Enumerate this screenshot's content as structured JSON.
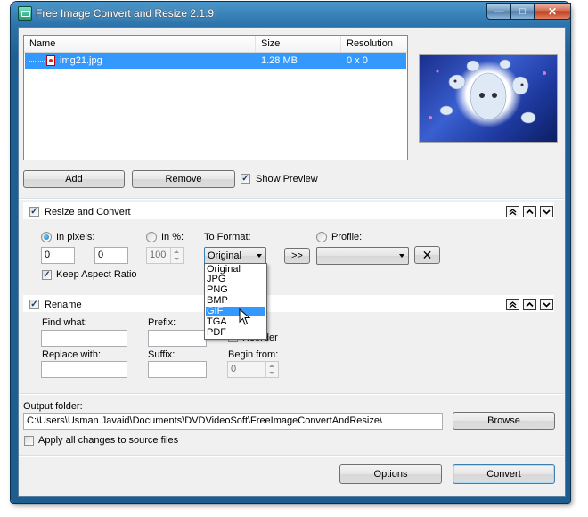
{
  "window": {
    "title": "Free Image Convert and Resize 2.1.9",
    "minimize_glyph": "—",
    "maximize_glyph": "□",
    "close_glyph": "✕"
  },
  "file_list": {
    "columns": [
      "Name",
      "Size",
      "Resolution"
    ],
    "rows": [
      {
        "name": "img21.jpg",
        "size": "1.28 MB",
        "resolution": "0 x 0",
        "selected": true
      }
    ]
  },
  "buttons": {
    "add": "Add",
    "remove": "Remove",
    "browse": "Browse",
    "options": "Options",
    "convert": "Convert",
    "apply_profile": ">>",
    "delete_profile": "✕"
  },
  "show_preview": {
    "label": "Show Preview",
    "checked": true
  },
  "resize_section": {
    "label": "Resize and Convert",
    "checked": true,
    "in_pixels_label": "In pixels:",
    "in_pixels_selected": true,
    "width_value": "0",
    "height_value": "0",
    "in_percent_label": "In %:",
    "percent_value": "100",
    "keep_aspect_label": "Keep Aspect Ratio",
    "keep_aspect_checked": true,
    "to_format_label": "To Format:",
    "format_selected": "Original",
    "format_options": [
      "Original",
      "JPG",
      "PNG",
      "BMP",
      "GIF",
      "TGA",
      "PDF"
    ],
    "format_highlighted": "GIF",
    "profile_label": "Profile:",
    "profile_value": ""
  },
  "rename_section": {
    "label": "Rename",
    "checked": true,
    "find_what_label": "Find what:",
    "find_what_value": "",
    "replace_with_label": "Replace with:",
    "replace_with_value": "",
    "prefix_label": "Prefix:",
    "prefix_value": "",
    "suffix_label": "Suffix:",
    "suffix_value": "",
    "reorder_label": "Reorder",
    "reorder_checked": false,
    "begin_from_label": "Begin from:",
    "begin_from_value": "0"
  },
  "output": {
    "label": "Output folder:",
    "path": "C:\\Users\\Usman Javaid\\Documents\\DVDVideoSoft\\FreeImageConvertAndResize\\",
    "apply_all_label": "Apply all changes to source files",
    "apply_all_checked": false
  },
  "colors": {
    "selection": "#3399ff",
    "titlebar": "#2c73ab",
    "close_button": "#c7442a"
  }
}
